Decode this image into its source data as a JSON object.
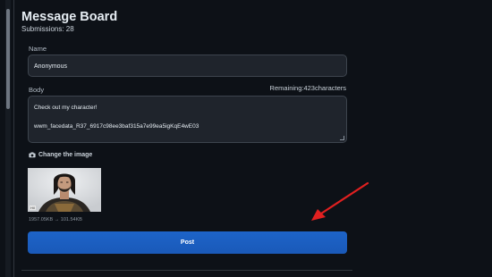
{
  "page": {
    "title": "Message Board",
    "submissions": "Submissions: 28"
  },
  "form": {
    "name_label": "Name",
    "name_value": "Anonymous",
    "body_label": "Body",
    "remaining": "Remaining:423characters",
    "body_line1": "Check out my character!",
    "body_line2": "wwm_facedata_R37_6917c98ee3baf315a7e99ea5igKqE4wE03",
    "change_image_label": "Change the image",
    "thumbnail_badge": "Hil",
    "size_info": "1957.05KB → 101.54KB",
    "post_label": "Post"
  },
  "colors": {
    "background": "#0d1117",
    "field": "#1f242c",
    "accent": "#1f6feb",
    "annotation_arrow": "#e02020"
  },
  "icons": [
    "camera-icon",
    "annotation-arrow"
  ]
}
